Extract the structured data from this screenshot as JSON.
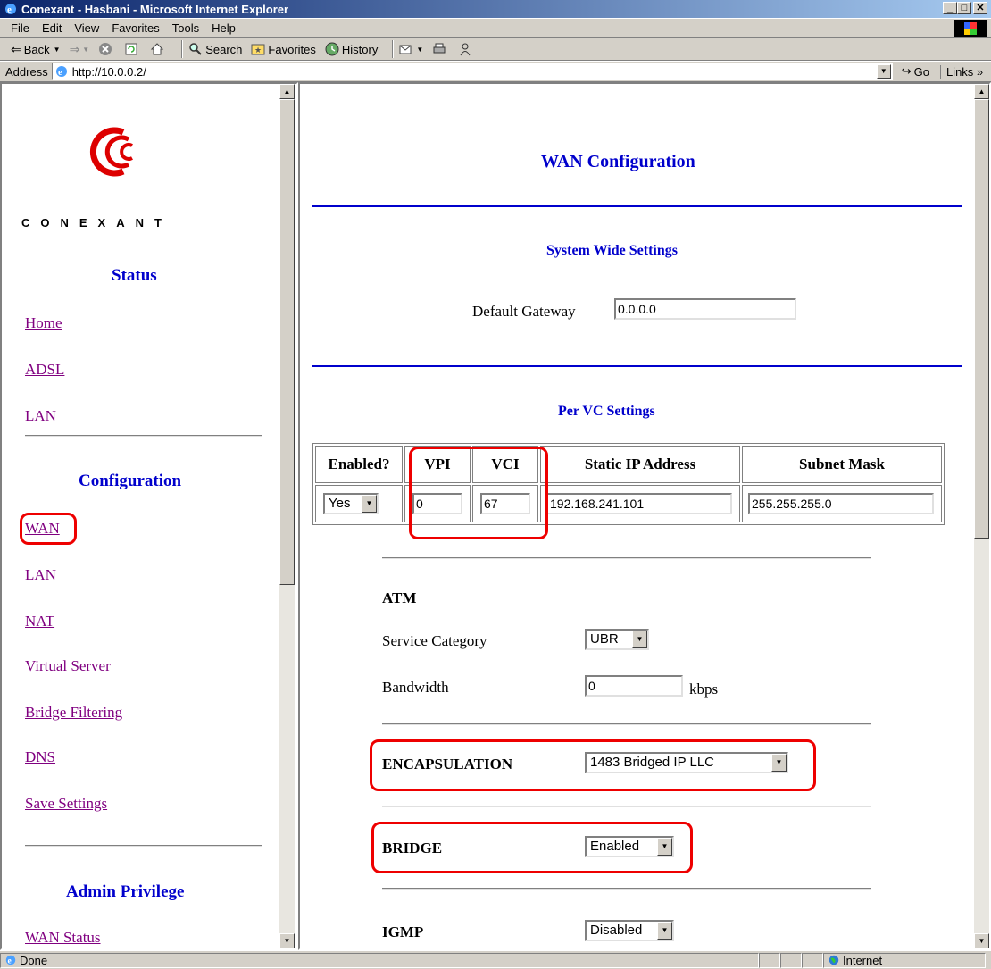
{
  "window": {
    "title": "Conexant - Hasbani - Microsoft Internet Explorer"
  },
  "menu": [
    "File",
    "Edit",
    "View",
    "Favorites",
    "Tools",
    "Help"
  ],
  "toolbar": {
    "back": "Back",
    "search": "Search",
    "favorites": "Favorites",
    "history": "History"
  },
  "address": {
    "label": "Address",
    "url": "http://10.0.0.2/",
    "go": "Go",
    "links": "Links"
  },
  "left": {
    "brand": "CONEXANT",
    "status_heading": "Status",
    "status_links": [
      "Home",
      "ADSL",
      "LAN"
    ],
    "config_heading": "Configuration",
    "config_links": [
      "WAN",
      "LAN",
      "NAT",
      "Virtual Server",
      "Bridge Filtering",
      "DNS",
      "Save Settings"
    ],
    "admin_heading": "Admin Privilege",
    "admin_links": [
      "WAN Status"
    ]
  },
  "main": {
    "title": "WAN Configuration",
    "system_heading": "System Wide Settings",
    "default_gateway_label": "Default Gateway",
    "default_gateway_value": "0.0.0.0",
    "pervc_heading": "Per VC Settings",
    "table": {
      "headers": [
        "Enabled?",
        "VPI",
        "VCI",
        "Static IP Address",
        "Subnet Mask"
      ],
      "row": {
        "enabled": "Yes",
        "vpi": "0",
        "vci": "67",
        "ip": "192.168.241.101",
        "mask": "255.255.255.0"
      }
    },
    "atm_heading": "ATM",
    "service_category_label": "Service Category",
    "service_category_value": "UBR",
    "bandwidth_label": "Bandwidth",
    "bandwidth_value": "0",
    "bandwidth_unit": "kbps",
    "encapsulation_label": "ENCAPSULATION",
    "encapsulation_value": "1483 Bridged IP LLC",
    "bridge_label": "BRIDGE",
    "bridge_value": "Enabled",
    "igmp_label": "IGMP",
    "igmp_value": "Disabled"
  },
  "status": {
    "text": "Done",
    "zone": "Internet"
  },
  "colors": {
    "heading_blue": "#0000cc",
    "visited_link": "#800080",
    "highlight_red": "#ee0000",
    "titlebar": "#0a246a"
  }
}
